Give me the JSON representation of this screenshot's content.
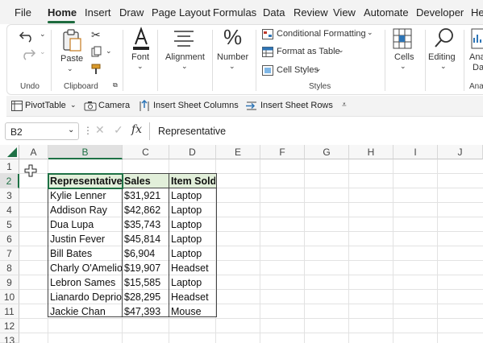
{
  "menu": {
    "items": [
      "File",
      "Home",
      "Insert",
      "Draw",
      "Page Layout",
      "Formulas",
      "Data",
      "Review",
      "View",
      "Automate",
      "Developer",
      "Help"
    ],
    "active": "Home"
  },
  "ribbon": {
    "undo": {
      "group_label": "Undo"
    },
    "clipboard": {
      "paste_label": "Paste",
      "group_label": "Clipboard"
    },
    "font": {
      "label": "Font"
    },
    "alignment": {
      "label": "Alignment"
    },
    "number": {
      "label": "Number",
      "symbol": "%"
    },
    "styles": {
      "conditional_formatting": "Conditional Formatting",
      "format_as_table": "Format as Table",
      "cell_styles": "Cell Styles",
      "group_label": "Styles"
    },
    "cells": {
      "label": "Cells"
    },
    "editing": {
      "label": "Editing"
    },
    "analyze": {
      "label_line1": "Ana",
      "label_line2": "Da",
      "group_label": "Ana"
    }
  },
  "qat": {
    "pivot_table": "PivotTable",
    "camera": "Camera",
    "insert_sheet_columns": "Insert Sheet Columns",
    "insert_sheet_rows": "Insert Sheet Rows"
  },
  "formula_bar": {
    "name_box": "B2",
    "fx": "fx",
    "value": "Representative"
  },
  "columns": [
    "A",
    "B",
    "C",
    "D",
    "E",
    "F",
    "G",
    "H",
    "I",
    "J"
  ],
  "rows": [
    "1",
    "2",
    "3",
    "4",
    "5",
    "6",
    "7",
    "8",
    "9",
    "10",
    "11",
    "12",
    "13"
  ],
  "table": {
    "headers": [
      "Representative",
      "Sales",
      "Item Sold"
    ],
    "rows": [
      [
        "Kylie Lenner",
        "$31,921",
        "Laptop"
      ],
      [
        "Addison Ray",
        "$42,862",
        "Laptop"
      ],
      [
        "Dua Lupa",
        "$35,743",
        "Laptop"
      ],
      [
        "Justin Fever",
        "$45,814",
        "Laptop"
      ],
      [
        "Bill Bates",
        "$6,904",
        "Laptop"
      ],
      [
        "Charly O'Amelio",
        "$19,907",
        "Headset"
      ],
      [
        "Lebron Sames",
        "$15,585",
        "Laptop"
      ],
      [
        "Lianardo Deprio",
        "$28,295",
        "Headset"
      ],
      [
        "Jackie Chan",
        "$47,393",
        "Mouse"
      ]
    ]
  },
  "colors": {
    "accent": "#1e7145",
    "header_fill": "#e2efda"
  }
}
